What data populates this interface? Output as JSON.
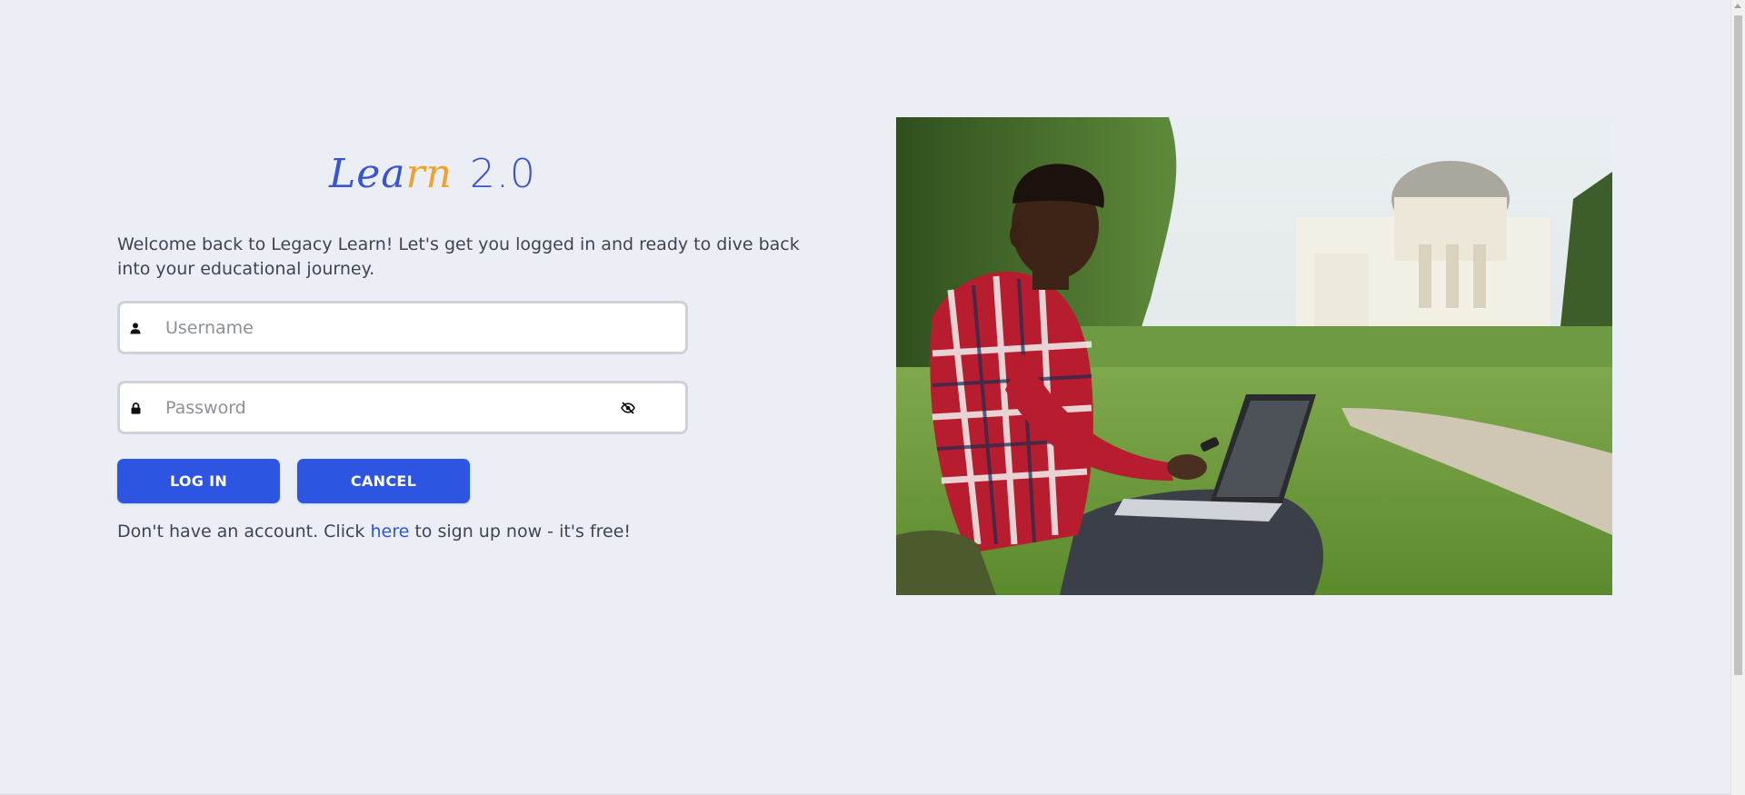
{
  "logo": {
    "part1": "Lea",
    "part2": "rn",
    "part3": "2.0"
  },
  "welcome_text": "Welcome back to Legacy Learn! Let's get you logged in and ready to dive back into your educational journey.",
  "form": {
    "username": {
      "placeholder": "Username",
      "value": "",
      "icon": "user-icon"
    },
    "password": {
      "placeholder": "Password",
      "value": "",
      "icon": "lock-icon",
      "toggle_icon": "eye-slash-icon"
    }
  },
  "buttons": {
    "login_label": "LOG IN",
    "cancel_label": "CANCEL"
  },
  "signup": {
    "prefix": "Don't have an account. Click ",
    "link_text": "here",
    "suffix": " to sign up now - it's free!"
  },
  "colors": {
    "background": "#ebeef5",
    "primary": "#2d55e1",
    "logo_accent": "#f1a22a",
    "text": "#3e4451"
  }
}
